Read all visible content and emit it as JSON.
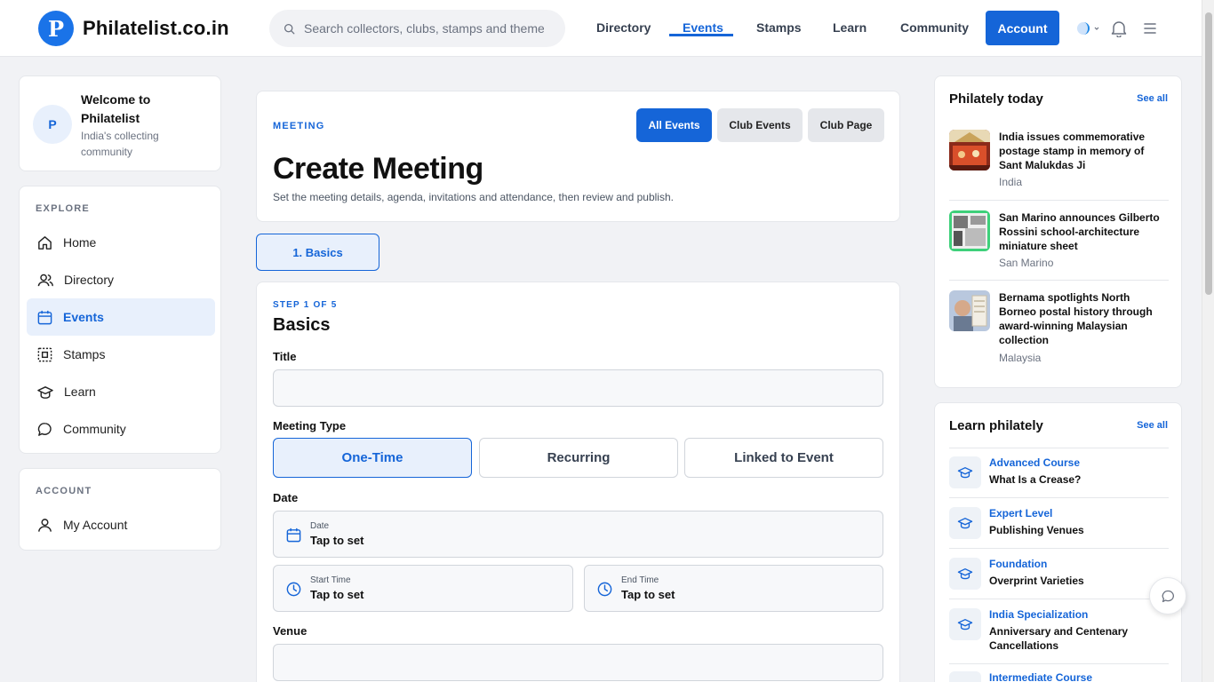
{
  "brand": {
    "logo_letter": "P",
    "name": "Philatelist.co.in"
  },
  "search": {
    "placeholder": "Search collectors, clubs, stamps and themes"
  },
  "topnav": {
    "directory": "Directory",
    "events": "Events",
    "stamps": "Stamps",
    "learn": "Learn",
    "community": "Community",
    "account": "Account"
  },
  "colors": {
    "accent": "#1565d8",
    "accent_soft": "#e8f0fc",
    "page_bg": "#f1f2f5"
  },
  "welcome": {
    "avatar": "P",
    "title": "Welcome to Philatelist",
    "subtitle": "India's collecting community"
  },
  "sidebar": {
    "explore_label": "EXPLORE",
    "items": [
      {
        "label": "Home",
        "icon": "home-icon"
      },
      {
        "label": "Directory",
        "icon": "users-icon"
      },
      {
        "label": "Events",
        "icon": "calendar-icon"
      },
      {
        "label": "Stamps",
        "icon": "stamp-icon"
      },
      {
        "label": "Learn",
        "icon": "graduation-cap-icon"
      },
      {
        "label": "Community",
        "icon": "chat-bubble-icon"
      }
    ],
    "account_label": "ACCOUNT",
    "account_item": "My Account"
  },
  "hero": {
    "eyebrow": "MEETING",
    "title": "Create Meeting",
    "description": "Set the meeting details, agenda, invitations and attendance, then review and publish.",
    "buttons": {
      "all_events": "All Events",
      "club_events": "Club Events",
      "club_page": "Club Page"
    }
  },
  "step_tab": "1. Basics",
  "form": {
    "step": "STEP 1 OF 5",
    "heading": "Basics",
    "title_label": "Title",
    "title_value": "",
    "meeting_type_label": "Meeting Type",
    "meeting_types": [
      "One-Time",
      "Recurring",
      "Linked to Event"
    ],
    "date_label": "Date",
    "date_picker": {
      "label": "Date",
      "value": "Tap to set"
    },
    "start_time": {
      "label": "Start Time",
      "value": "Tap to set"
    },
    "end_time": {
      "label": "End Time",
      "value": "Tap to set"
    },
    "venue_label": "Venue",
    "venue_value": ""
  },
  "philately_today": {
    "heading": "Philately today",
    "see_all": "See all",
    "items": [
      {
        "title": "India issues commemorative postage stamp in memory of Sant Malukdas Ji",
        "country": "India"
      },
      {
        "title": "San Marino announces Gilberto Rossini school-architecture miniature sheet",
        "country": "San Marino"
      },
      {
        "title": "Bernama spotlights North Borneo postal history through award-winning Malaysian collection",
        "country": "Malaysia"
      }
    ]
  },
  "learn_philately": {
    "heading": "Learn philately",
    "see_all": "See all",
    "courses": [
      {
        "level": "Advanced Course",
        "title": "What Is a Crease?"
      },
      {
        "level": "Expert Level",
        "title": "Publishing Venues"
      },
      {
        "level": "Foundation",
        "title": "Overprint Varieties"
      },
      {
        "level": "India Specialization",
        "title": "Anniversary and Centenary Cancellations"
      },
      {
        "level": "Intermediate Course",
        "title": ""
      }
    ]
  }
}
